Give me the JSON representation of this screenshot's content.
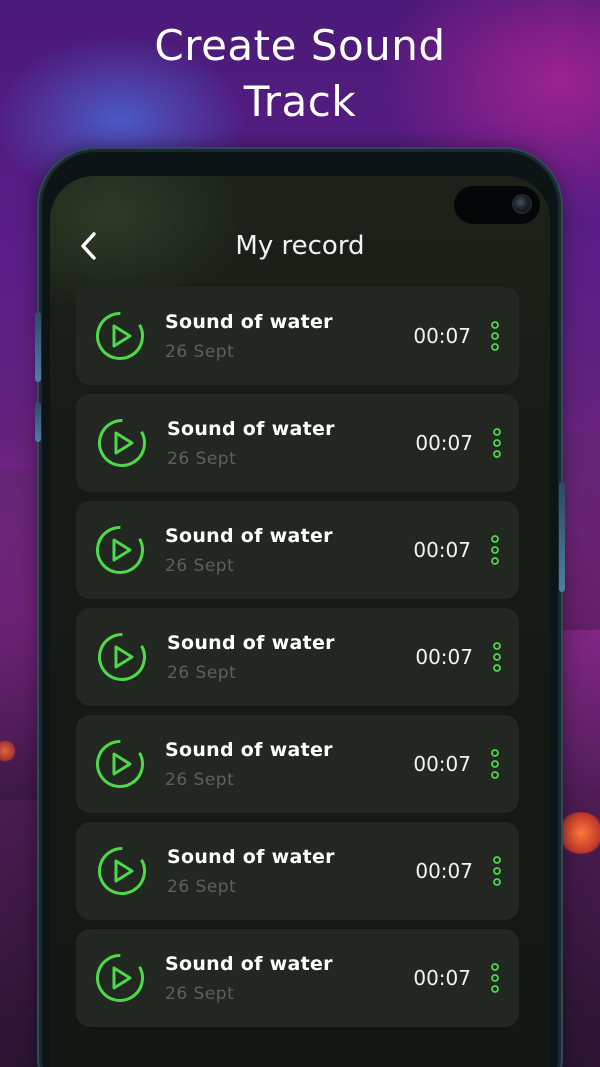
{
  "promo": {
    "headline_line1": "Create Sound",
    "headline_line2": "Track"
  },
  "screen": {
    "title": "My record",
    "back_icon": "chevron-left-icon"
  },
  "colors": {
    "accent": "#4cd94a",
    "row_bg": "#232721",
    "screen_bg": "#151915",
    "muted_text": "#5e6159"
  },
  "records": [
    {
      "name": "Sound of water",
      "date": "26 Sept",
      "duration": "00:07"
    },
    {
      "name": "Sound of water",
      "date": "26 Sept",
      "duration": "00:07"
    },
    {
      "name": "Sound of water",
      "date": "26 Sept",
      "duration": "00:07"
    },
    {
      "name": "Sound of water",
      "date": "26 Sept",
      "duration": "00:07"
    },
    {
      "name": "Sound of water",
      "date": "26 Sept",
      "duration": "00:07"
    },
    {
      "name": "Sound of water",
      "date": "26 Sept",
      "duration": "00:07"
    },
    {
      "name": "Sound of water",
      "date": "26 Sept",
      "duration": "00:07"
    }
  ],
  "row_icons": {
    "play": "play-circle-icon",
    "more": "more-vertical-icon"
  }
}
